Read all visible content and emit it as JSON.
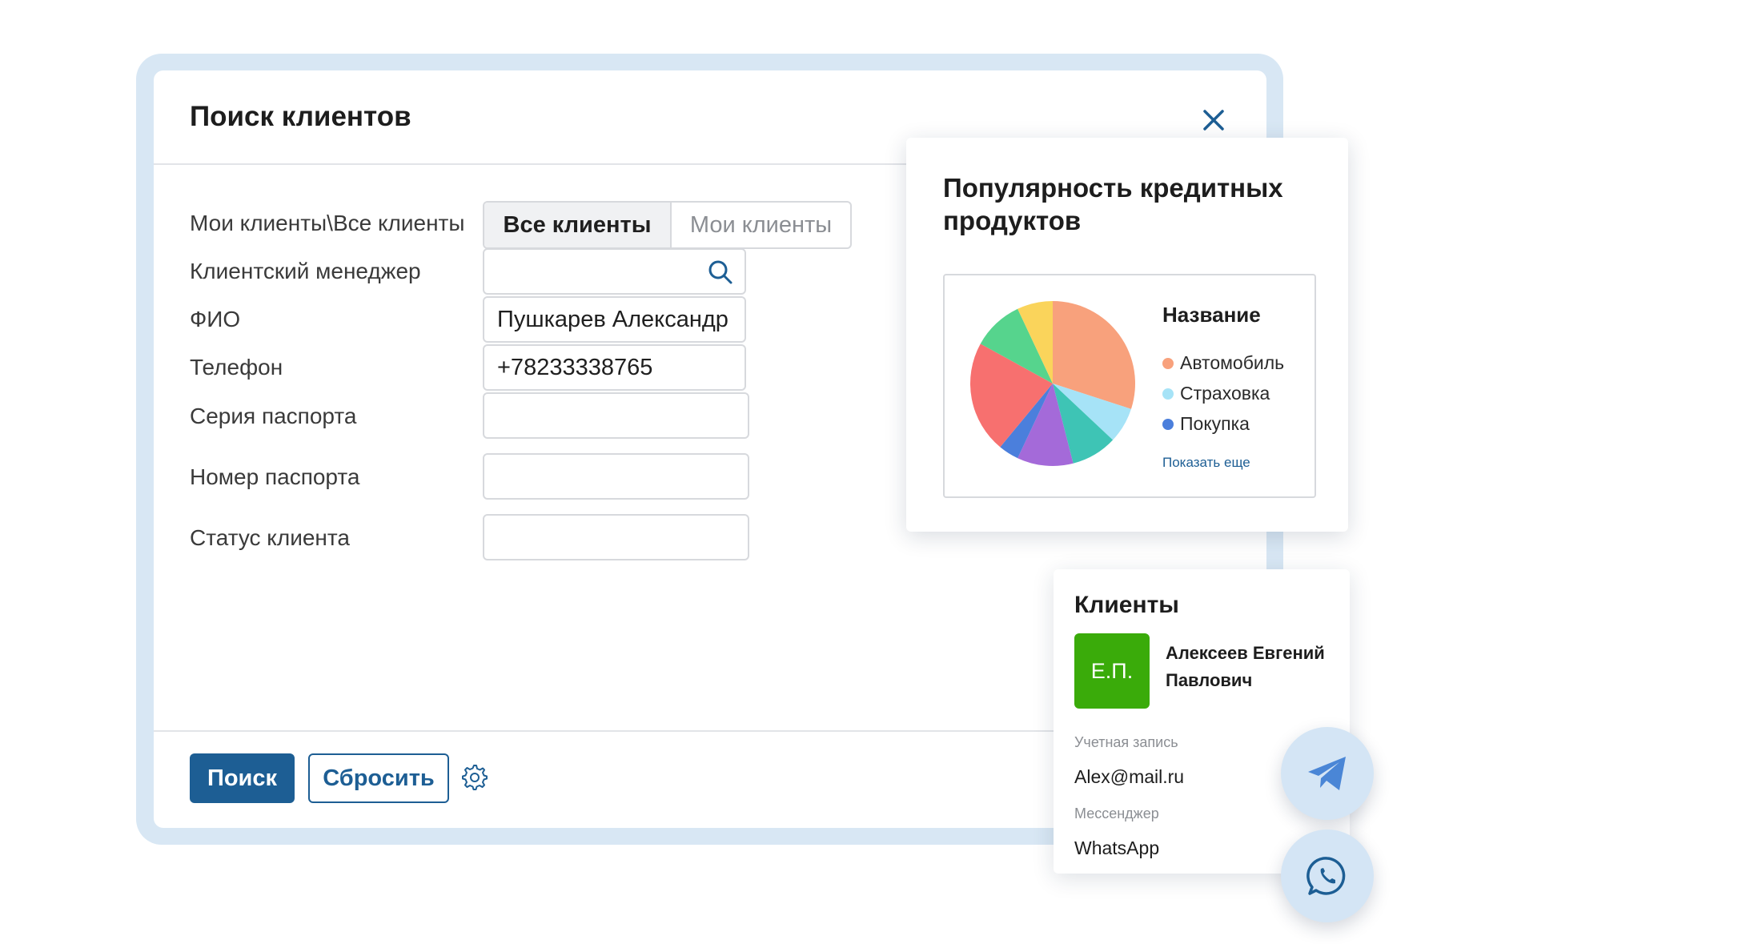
{
  "dialog": {
    "title": "Поиск клиентов",
    "fields": {
      "scope_label": "Мои клиенты\\Все клиенты",
      "scope_options": [
        "Все клиенты",
        "Мои клиенты"
      ],
      "manager_label": "Клиентский менеджер",
      "manager_value": "",
      "fio_label": "ФИО",
      "fio_value": "Пушкарев Александр Сергеевич",
      "phone_label": "Телефон",
      "phone_value": "+78233338765",
      "passport_series_label": "Серия паспорта",
      "passport_number_label": "Номер паспорта",
      "status_label": "Статус клиента"
    },
    "search_button": "Поиск",
    "reset_button": "Сбросить"
  },
  "pie_card": {
    "title": "Популярность кредитных продуктов",
    "legend_title": "Название",
    "legend": [
      {
        "label": "Автомобиль",
        "color": "#f8a17c"
      },
      {
        "label": "Страховка",
        "color": "#a6e3f7"
      },
      {
        "label": "Покупка",
        "color": "#4b7fdc"
      }
    ],
    "show_more": "Показать еще"
  },
  "chart_data": {
    "type": "pie",
    "title": "Популярность кредитных продуктов",
    "slices": [
      {
        "label": "Автомобиль",
        "value": 30,
        "color": "#f8a17c"
      },
      {
        "label": "Страховка",
        "value": 7,
        "color": "#a6e3f7"
      },
      {
        "label": "",
        "value": 9,
        "color": "#3ec4b5"
      },
      {
        "label": "",
        "value": 11,
        "color": "#a46ad9"
      },
      {
        "label": "Покупка",
        "value": 4,
        "color": "#4b7fdc"
      },
      {
        "label": "",
        "value": 22,
        "color": "#f7706f"
      },
      {
        "label": "",
        "value": 10,
        "color": "#56d48d"
      },
      {
        "label": "",
        "value": 7,
        "color": "#fad45b"
      }
    ],
    "legend_position": "right"
  },
  "client_card": {
    "title": "Клиенты",
    "initials": "Е.П.",
    "name": "Алексеев Евгений Павлович",
    "account_caption": "Учетная запись",
    "account_value": "Alex@mail.ru",
    "messenger_caption": "Мессенджер",
    "messenger_value": "WhatsApp",
    "avatar_color": "#3aab0a"
  },
  "icons": {
    "close": "close-icon",
    "search": "search-icon",
    "settings": "gear-icon",
    "telegram": "telegram-icon",
    "whatsapp": "whatsapp-icon"
  },
  "colors": {
    "accent": "#1d5e94",
    "frame": "#d8e7f4",
    "messenger_button": "#d4e5f5"
  }
}
